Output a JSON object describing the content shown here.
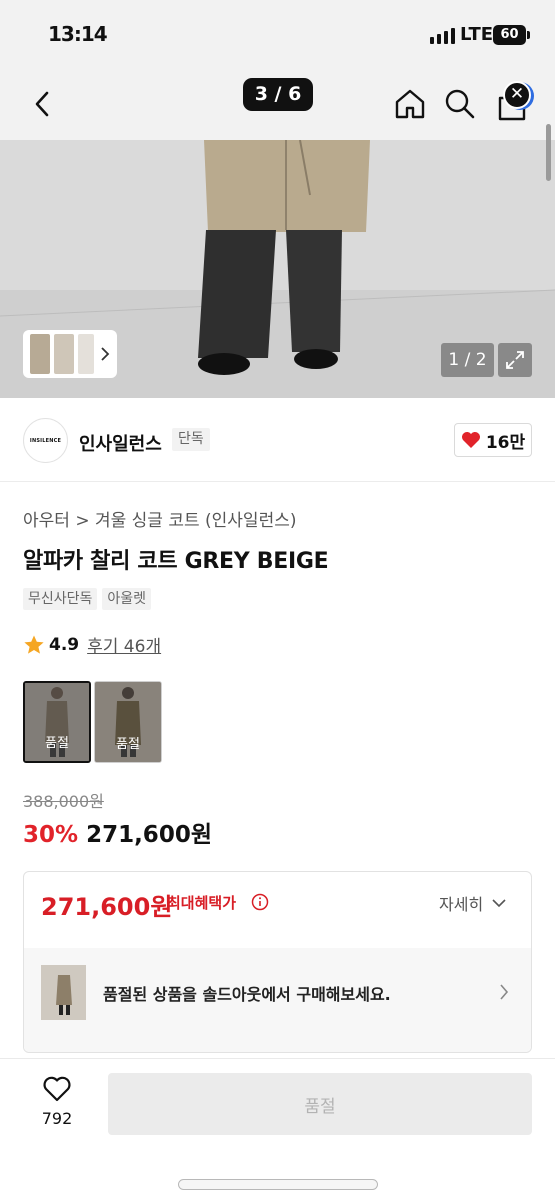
{
  "status_bar": {
    "time": "13:14",
    "network": "LTE",
    "battery": "60"
  },
  "header": {
    "page_counter": "3 / 6",
    "icons": [
      "chevron-left-icon",
      "home-icon",
      "search-icon",
      "cart-icon",
      "close-icon"
    ]
  },
  "gallery": {
    "image_indicator": "1 / 2"
  },
  "brand": {
    "logo_text": "INSILENCE",
    "name": "인사일런스",
    "tag": "단독",
    "likes": "16만"
  },
  "product": {
    "category_path": "아우터 > 겨울 싱글 코트 (인사일런스)",
    "title": "알파카 찰리 코트 GREY BEIGE",
    "tags": [
      "무신사단독",
      "아울렛"
    ],
    "rating": "4.9",
    "reviews": "후기 46개",
    "options": [
      {
        "label": "품절"
      },
      {
        "label": "품절"
      }
    ],
    "original_price": "388,000원",
    "discount": "30%",
    "sale_price": "271,600원"
  },
  "benefit": {
    "price": "271,600원",
    "label": "최대혜택가",
    "detail_label": "자세히",
    "soldout_message": "품절된 상품을 솔드아웃에서 구매해보세요."
  },
  "bottom_bar": {
    "wish_count": "792",
    "buy_label": "품절"
  },
  "colors": {
    "accent_red": "#e1232a",
    "badge_blue": "#2f6de1",
    "disabled_button": "#ebebeb"
  }
}
